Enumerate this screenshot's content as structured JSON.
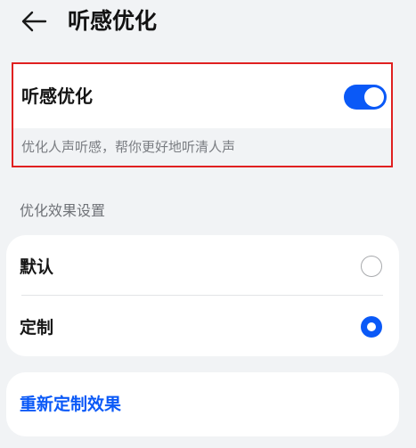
{
  "header": {
    "title": "听感优化"
  },
  "toggle": {
    "label": "听感优化",
    "enabled": true,
    "description": "优化人声听感，帮你更好地听清人声",
    "accent_color": "#0a59f7",
    "highlight_border_color": "#e02020"
  },
  "effect_settings": {
    "section_title": "优化效果设置",
    "options": [
      {
        "label": "默认",
        "selected": false
      },
      {
        "label": "定制",
        "selected": true
      }
    ]
  },
  "recustomize": {
    "label": "重新定制效果"
  },
  "icons": {
    "back": "arrow-left-icon"
  }
}
